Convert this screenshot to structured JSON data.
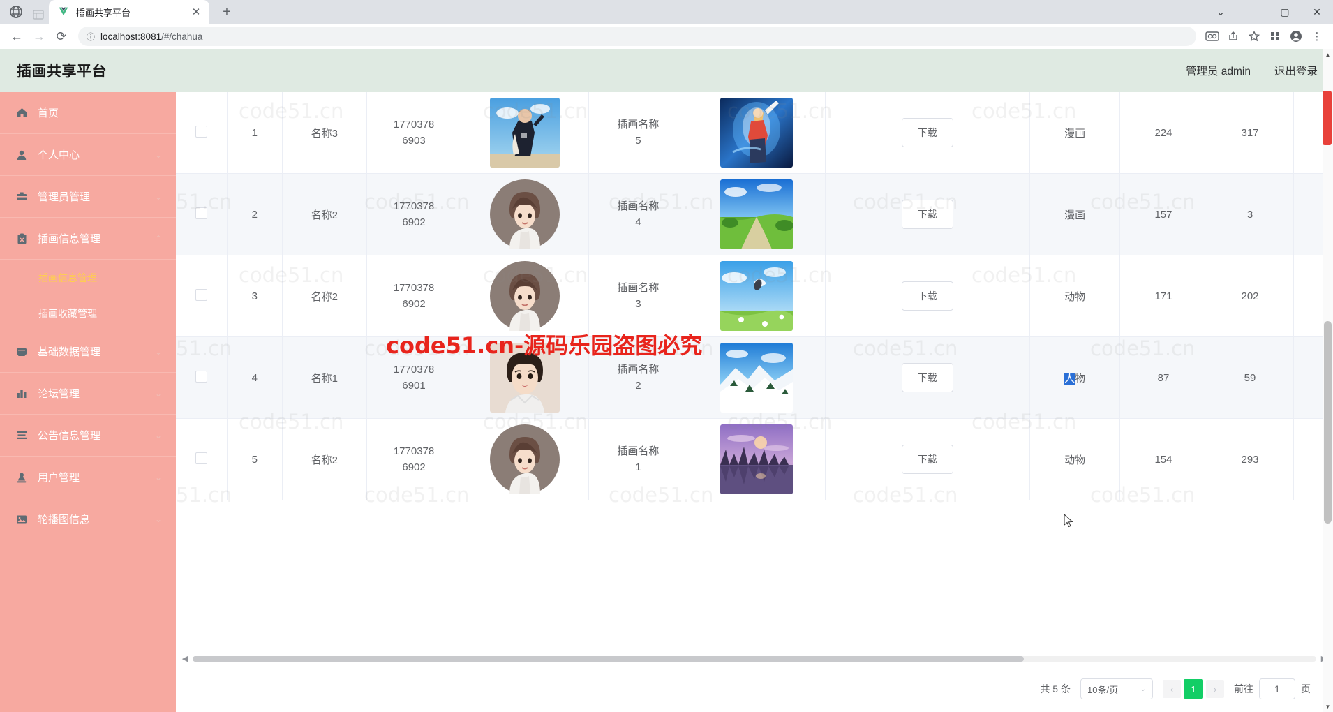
{
  "browser": {
    "tab_title": "插画共享平台",
    "tab_close_icon": "close-icon",
    "new_tab_icon": "plus-icon",
    "back_icon": "back-arrow-icon",
    "forward_icon": "forward-arrow-icon",
    "reload_icon": "reload-icon",
    "security_icon": "info-circle-icon",
    "url_host": "localhost:8081",
    "url_path": "/#/chahua",
    "url_full": "localhost:8081/#/chahua",
    "toolbar_icons": [
      "card-icon",
      "share-icon",
      "star-icon",
      "extensions-icon",
      "profile-icon",
      "menu-icon"
    ],
    "window_controls": [
      "chevron-down-icon",
      "minimize-icon",
      "maximize-icon",
      "close-icon"
    ]
  },
  "header": {
    "brand": "插画共享平台",
    "user": "管理员 admin",
    "logout": "退出登录"
  },
  "sidebar": {
    "items": [
      {
        "label": "首页",
        "icon": "home-icon",
        "has_chevron": false,
        "chevron": ""
      },
      {
        "label": "个人中心",
        "icon": "user-icon",
        "has_chevron": true,
        "chevron": "⌄"
      },
      {
        "label": "管理员管理",
        "icon": "briefcase-icon",
        "has_chevron": true,
        "chevron": "⌄"
      },
      {
        "label": "插画信息管理",
        "icon": "clipboard-icon",
        "has_chevron": true,
        "chevron": "⌃"
      },
      {
        "label": "基础数据管理",
        "icon": "database-icon",
        "has_chevron": true,
        "chevron": "⌄"
      },
      {
        "label": "论坛管理",
        "icon": "chart-bar-icon",
        "has_chevron": true,
        "chevron": "⌄"
      },
      {
        "label": "公告信息管理",
        "icon": "list-icon",
        "has_chevron": true,
        "chevron": "⌄"
      },
      {
        "label": "用户管理",
        "icon": "user-badge-icon",
        "has_chevron": true,
        "chevron": "⌄"
      },
      {
        "label": "轮播图信息",
        "icon": "image-icon",
        "has_chevron": true,
        "chevron": "⌄"
      }
    ],
    "submenu": [
      {
        "label": "插画信息管理",
        "active": true
      },
      {
        "label": "插画收藏管理",
        "active": false
      }
    ]
  },
  "table": {
    "download_label": "下载",
    "rows": [
      {
        "index": "1",
        "name": "名称3",
        "phone_top": "1770378",
        "phone_bottom": "6903",
        "title_top": "插画名称",
        "title_bottom": "5",
        "type": "漫画",
        "num1": "224",
        "num2": "317",
        "avatar": "person-photo-1",
        "cover": "cover-anime-1"
      },
      {
        "index": "2",
        "name": "名称2",
        "phone_top": "1770378",
        "phone_bottom": "6902",
        "title_top": "插画名称",
        "title_bottom": "4",
        "type": "漫画",
        "num1": "157",
        "num2": "3",
        "avatar": "avatar-illustration-1",
        "cover": "cover-field"
      },
      {
        "index": "3",
        "name": "名称2",
        "phone_top": "1770378",
        "phone_bottom": "6902",
        "title_top": "插画名称",
        "title_bottom": "3",
        "type": "动物",
        "num1": "171",
        "num2": "202",
        "avatar": "avatar-illustration-1",
        "cover": "cover-sky"
      },
      {
        "index": "4",
        "name": "名称1",
        "phone_top": "1770378",
        "phone_bottom": "6901",
        "title_top": "插画名称",
        "title_bottom": "2",
        "type": "人物",
        "type_selected_char": "人",
        "type_rest": "物",
        "num1": "87",
        "num2": "59",
        "avatar": "person-photo-2",
        "cover": "cover-snow"
      },
      {
        "index": "5",
        "name": "名称2",
        "phone_top": "1770378",
        "phone_bottom": "6902",
        "title_top": "插画名称",
        "title_bottom": "1",
        "type": "动物",
        "num1": "154",
        "num2": "293",
        "avatar": "avatar-illustration-1",
        "cover": "cover-sunset"
      }
    ]
  },
  "pagination": {
    "total": "共 5 条",
    "page_size": "10条/页",
    "prev_icon": "chevron-left-icon",
    "next_icon": "chevron-right-icon",
    "current_page": "1",
    "goto_label": "前往",
    "goto_value": "1",
    "page_unit": "页"
  },
  "watermark": {
    "tile": "code51.cn",
    "red_text": "code51.cn-源码乐园盗图必究"
  },
  "colors": {
    "sidebar": "#f7a9a0",
    "header": "#dfeae2",
    "accent_green": "#13ce66",
    "active_menu": "#ffd04b",
    "watermark_red": "#e8241c"
  }
}
